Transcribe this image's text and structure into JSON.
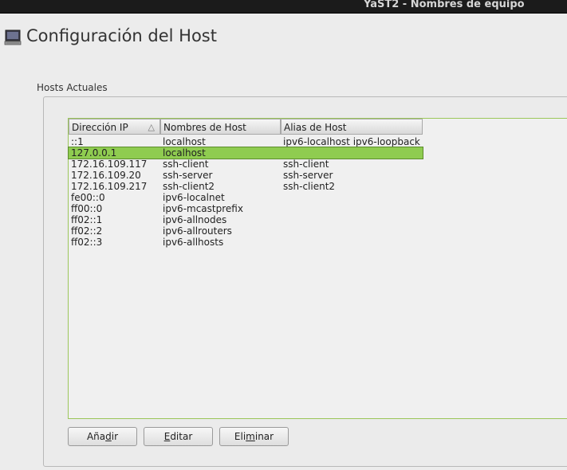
{
  "window": {
    "title": "YaST2 - Nombres de equipo"
  },
  "header": {
    "icon": "computer-monitor-icon",
    "title": "Configuración del Host"
  },
  "group": {
    "label": "Hosts Actuales"
  },
  "table": {
    "columns": [
      {
        "label": "Dirección IP",
        "sort_icon": "sort-ascending-icon",
        "sorted": true
      },
      {
        "label": "Nombres de Host"
      },
      {
        "label": "Alias de Host"
      }
    ],
    "selected_row": 1,
    "rows": [
      {
        "ip": "::1",
        "hostname": "localhost",
        "alias": "ipv6-localhost ipv6-loopback"
      },
      {
        "ip": "127.0.0.1",
        "hostname": "localhost",
        "alias": ""
      },
      {
        "ip": "172.16.109.117",
        "hostname": "ssh-client",
        "alias": "ssh-client"
      },
      {
        "ip": "172.16.109.20",
        "hostname": "ssh-server",
        "alias": "ssh-server"
      },
      {
        "ip": "172.16.109.217",
        "hostname": "ssh-client2",
        "alias": "ssh-client2"
      },
      {
        "ip": "fe00::0",
        "hostname": "ipv6-localnet",
        "alias": ""
      },
      {
        "ip": "ff00::0",
        "hostname": "ipv6-mcastprefix",
        "alias": ""
      },
      {
        "ip": "ff02::1",
        "hostname": "ipv6-allnodes",
        "alias": ""
      },
      {
        "ip": "ff02::2",
        "hostname": "ipv6-allrouters",
        "alias": ""
      },
      {
        "ip": "ff02::3",
        "hostname": "ipv6-allhosts",
        "alias": ""
      }
    ]
  },
  "buttons": {
    "add": {
      "label": "Añadir",
      "mnemonic": "d"
    },
    "edit": {
      "label": "Editar",
      "mnemonic": "E"
    },
    "delete": {
      "label": "Eliminar",
      "mnemonic": "m"
    }
  },
  "colors": {
    "selection": "#8fcc50",
    "table_border": "#9bc65a"
  }
}
